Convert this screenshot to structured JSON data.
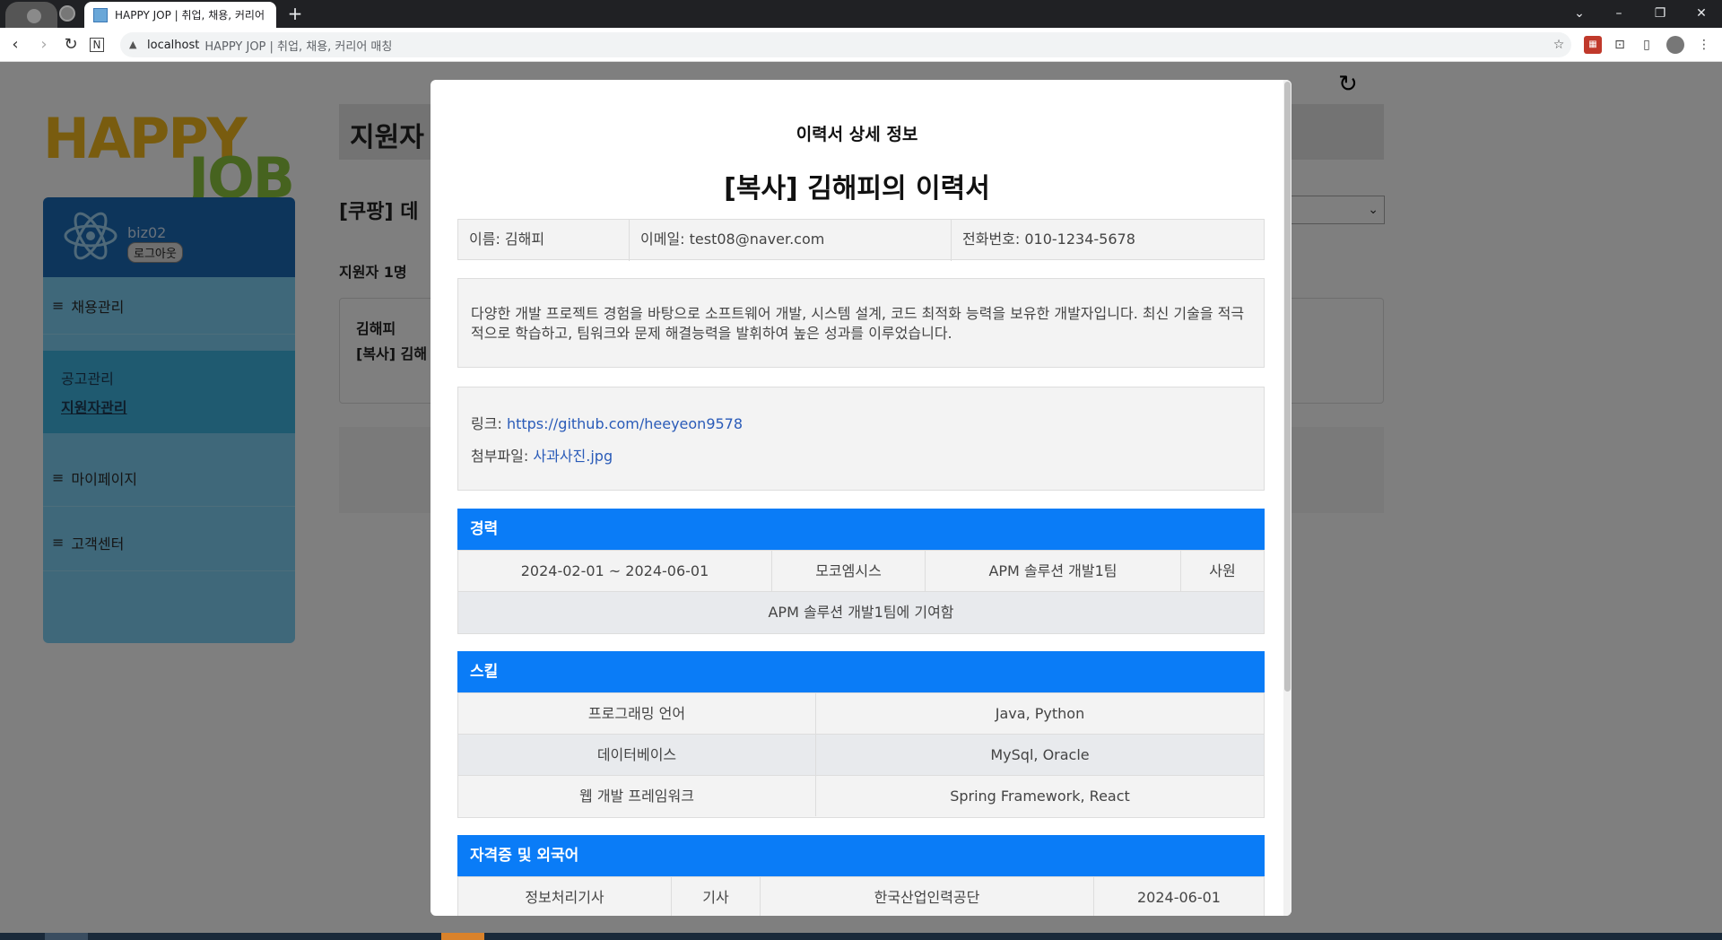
{
  "browser": {
    "tab_title": "HAPPY JOP | 취업, 채용, 커리어",
    "new_tab": "+",
    "url_host": "localhost",
    "url_rest": "HAPPY JOP | 취업, 채용, 커리어 매칭",
    "window_controls": [
      "⌄",
      "–",
      "❐",
      "✕"
    ]
  },
  "page": {
    "logo_happy": "HAPPY",
    "logo_job": "JOB",
    "user": {
      "name": "biz02",
      "logout_label": "로그아웃"
    },
    "menu": [
      {
        "label": "채용관리"
      },
      {
        "label": "마이페이지"
      },
      {
        "label": "고객센터"
      }
    ],
    "submenu": [
      {
        "label": "공고관리"
      },
      {
        "label": "지원자관리"
      }
    ],
    "content_title": "지원자",
    "posting_title": "[쿠팡] 데",
    "applicant_count": "지원자 1명",
    "applicant": {
      "name": "김해피",
      "resume_title": "[복사] 김해"
    },
    "refresh_symbol": "↻"
  },
  "modal": {
    "heading": "이력서 상세 정보",
    "resume_title": "[복사] 김해피의 이력서",
    "info": {
      "name": "이름: 김해피",
      "email": "이메일: test08@naver.com",
      "phone": "전화번호: 010-1234-5678"
    },
    "intro": "다양한 개발 프로젝트 경험을 바탕으로 소프트웨어 개발, 시스템 설계, 코드 최적화 능력을 보유한 개발자입니다. 최신 기술을 적극적으로 학습하고, 팀워크와 문제 해결능력을 발휘하여 높은 성과를 이루었습니다.",
    "link_label": "링크:",
    "link_url": "https://github.com/heeyeon9578",
    "file_label": "첨부파일:",
    "file_name": "사과사진.jpg",
    "career": {
      "title": "경력",
      "period": "2024-02-01 ~ 2024-06-01",
      "company": "모코엠시스",
      "department": "APM 솔루션 개발1팀",
      "position": "사원",
      "description": "APM 솔루션 개발1팀에 기여함"
    },
    "skills": {
      "title": "스킬",
      "rows": [
        {
          "category": "프로그래밍 언어",
          "value": "Java, Python"
        },
        {
          "category": "데이터베이스",
          "value": "MySql, Oracle"
        },
        {
          "category": "웹 개발 프레임워크",
          "value": "Spring Framework, React"
        }
      ]
    },
    "certs": {
      "title": "자격증 및 외국어",
      "rows": [
        {
          "name": "정보처리기사",
          "grade": "기사",
          "issuer": "한국산업인력공단",
          "date": "2024-06-01"
        }
      ]
    }
  },
  "colors": {
    "section_header": "#0a7cf7",
    "sidebar_user": "#1b6ab6",
    "sidebar_menu": "#7fd1f5"
  }
}
